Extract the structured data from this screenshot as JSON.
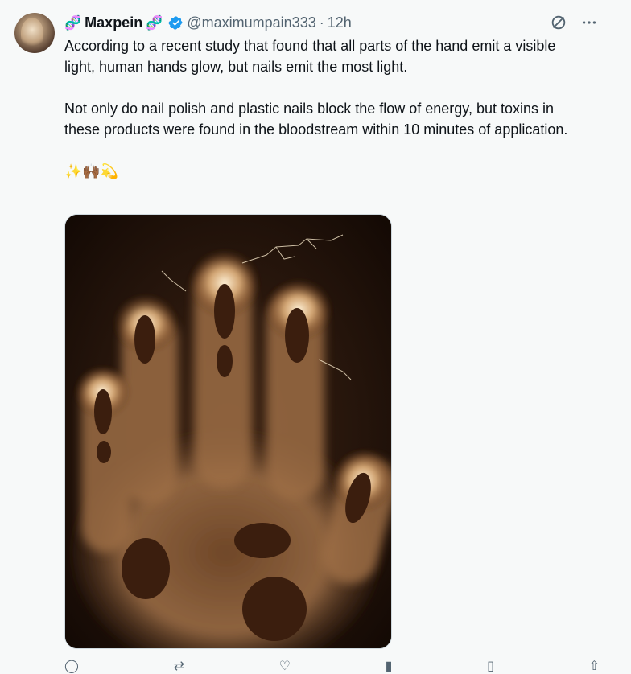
{
  "post": {
    "display_name": "Maxpein",
    "name_emoji_left": "🧬",
    "name_emoji_right": "🧬",
    "handle": "@maximumpain333",
    "separator": "·",
    "time": "12h",
    "paragraph_1": "According to a recent study that found that all parts of the hand emit a visible light, human hands glow, but nails emit the most light.",
    "paragraph_2": "Not only do nail polish and plastic nails block the flow of energy, but toxins in these products were found in the bloodstream within 10 minutes of application.",
    "emoji_line": "✨🙌🏾💫"
  },
  "header_actions": {
    "grok_icon": "⊘",
    "more_icon": "···"
  },
  "colors": {
    "accent": "#1d9bf0",
    "secondary_text": "#536471",
    "primary_text": "#0f1419",
    "background": "#f7f9f9",
    "dna_emoji": "#8a4fbf"
  },
  "icons": [
    "dna-emoji-icon",
    "verified-badge-icon",
    "grok-icon",
    "more-icon",
    "reply-icon",
    "repost-icon",
    "like-icon",
    "views-icon",
    "bookmark-icon",
    "share-icon"
  ]
}
